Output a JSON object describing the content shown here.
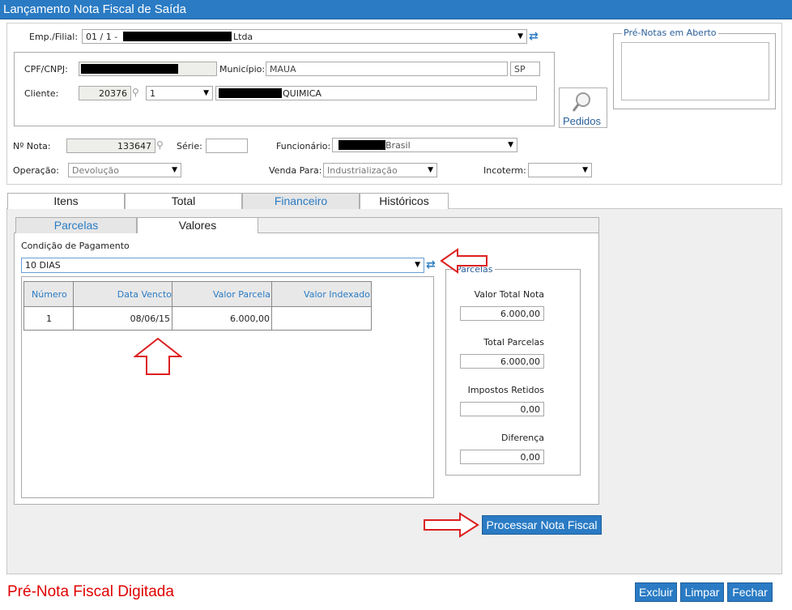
{
  "window": {
    "title": "Lançamento Nota Fiscal de Saída"
  },
  "header": {
    "emp_filial_label": "Emp./Filial:",
    "emp_filial_value_prefix": "01 / 1 -",
    "emp_filial_value_suffix": "Ltda",
    "cpf_label": "CPF/CNPJ:",
    "municipio_label": "Município:",
    "municipio_value": "MAUA",
    "uf_value": "SP",
    "cliente_label": "Cliente:",
    "cliente_code": "20376",
    "cliente_loja": "1",
    "cliente_name_suffix": "QUIMICA",
    "pedidos_label": "Pedidos",
    "pre_notas_label": "Pré-Notas em Aberto",
    "nota_label": "Nº Nota:",
    "nota_value": "133647",
    "serie_label": "Série:",
    "serie_value": "",
    "funcionario_label": "Funcionário:",
    "funcionario_suffix": "Brasil",
    "operacao_label": "Operação:",
    "operacao_value": "Devolução",
    "venda_para_label": "Venda Para:",
    "venda_para_value": "Industrialização",
    "incoterm_label": "Incoterm:",
    "incoterm_value": ""
  },
  "tabs": [
    "Itens",
    "Total",
    "Financeiro",
    "Históricos"
  ],
  "subtabs": [
    "Parcelas",
    "Valores"
  ],
  "financeiro": {
    "condicao_label": "Condição de Pagamento",
    "condicao_value": "10 DIAS",
    "grid_headers": [
      "Número",
      "Data Vencto",
      "Valor Parcela",
      "Valor Indexado"
    ],
    "grid_rows": [
      {
        "numero": "1",
        "data": "08/06/15",
        "valor": "6.000,00",
        "indexado": ""
      }
    ],
    "parcelas_group_label": "Parcelas",
    "valor_total_nota_label": "Valor Total Nota",
    "valor_total_nota": "6.000,00",
    "total_parcelas_label": "Total Parcelas",
    "total_parcelas": "6.000,00",
    "impostos_retidos_label": "Impostos Retidos",
    "impostos_retidos": "0,00",
    "diferenca_label": "Diferença",
    "diferenca": "0,00"
  },
  "actions": {
    "processar_label": "Processar Nota Fiscal",
    "excluir_label": "Excluir",
    "limpar_label": "Limpar",
    "fechar_label": "Fechar"
  },
  "status": {
    "message": "Pré-Nota Fiscal Digitada",
    "color": "#e00000"
  },
  "colors": {
    "accent": "#2a7bc4",
    "annotation_arrow": "#dd1f1f"
  }
}
